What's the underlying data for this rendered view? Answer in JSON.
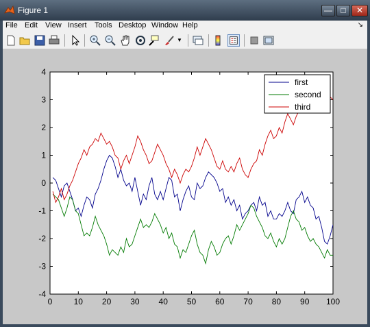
{
  "window": {
    "title": "Figure 1"
  },
  "menu": [
    "File",
    "Edit",
    "View",
    "Insert",
    "Tools",
    "Desktop",
    "Window",
    "Help"
  ],
  "toolbar": {
    "icons": [
      "new-file-icon",
      "open-folder-icon",
      "save-icon",
      "print-icon",
      "select-arrow-icon",
      "zoom-in-icon",
      "zoom-out-icon",
      "pan-hand-icon",
      "rotate-3d-icon",
      "data-cursor-icon",
      "brush-icon",
      "brush-dropdown-icon",
      "link-plot-icon",
      "colorbar-icon",
      "legend-icon",
      "hide-plot-tools-icon",
      "show-plot-tools-icon"
    ]
  },
  "colors": {
    "first": "#00008b",
    "second": "#007a00",
    "third": "#cc0000"
  },
  "chart_data": {
    "type": "line",
    "xlim": [
      0,
      100
    ],
    "ylim": [
      -4,
      4
    ],
    "xticks": [
      0,
      10,
      20,
      30,
      40,
      50,
      60,
      70,
      80,
      90,
      100
    ],
    "yticks": [
      4,
      3,
      2,
      1,
      0,
      -1,
      -2,
      -3,
      -4
    ],
    "grid": false,
    "legend_position": "top-right",
    "series": [
      {
        "name": "first",
        "color": "#00008b",
        "x": [
          1,
          2,
          3,
          4,
          5,
          6,
          7,
          8,
          9,
          10,
          11,
          12,
          13,
          14,
          15,
          16,
          17,
          18,
          19,
          20,
          21,
          22,
          23,
          24,
          25,
          26,
          27,
          28,
          29,
          30,
          31,
          32,
          33,
          34,
          35,
          36,
          37,
          38,
          39,
          40,
          41,
          42,
          43,
          44,
          45,
          46,
          47,
          48,
          49,
          50,
          51,
          52,
          53,
          54,
          55,
          56,
          57,
          58,
          59,
          60,
          61,
          62,
          63,
          64,
          65,
          66,
          67,
          68,
          69,
          70,
          71,
          72,
          73,
          74,
          75,
          76,
          77,
          78,
          79,
          80,
          81,
          82,
          83,
          84,
          85,
          86,
          87,
          88,
          89,
          90,
          91,
          92,
          93,
          94,
          95,
          96,
          97,
          98,
          99,
          100
        ],
        "y": [
          0.2,
          0.1,
          -0.2,
          -0.5,
          -0.1,
          0.0,
          -0.3,
          -0.6,
          -1.0,
          -0.9,
          -1.2,
          -0.8,
          -0.5,
          -0.6,
          -0.9,
          -0.4,
          -0.2,
          0.1,
          0.5,
          0.8,
          1.0,
          0.9,
          0.6,
          0.2,
          0.5,
          0.1,
          -0.1,
          0.0,
          -0.3,
          0.2,
          -0.3,
          -0.8,
          -0.4,
          -0.6,
          -0.1,
          0.2,
          -0.4,
          -0.6,
          -0.3,
          -0.6,
          -0.2,
          0.2,
          0.1,
          -0.5,
          -0.4,
          -1.0,
          -0.6,
          -0.3,
          -0.1,
          -0.5,
          -0.6,
          0.0,
          -0.2,
          -0.1,
          0.2,
          0.4,
          0.3,
          0.2,
          0.0,
          -0.3,
          -0.2,
          -0.7,
          -0.5,
          -0.8,
          -0.6,
          -1.0,
          -0.8,
          -1.3,
          -1.1,
          -1.0,
          -0.8,
          -0.7,
          -1.0,
          -0.5,
          -0.8,
          -0.7,
          -1.2,
          -1.0,
          -1.3,
          -1.3,
          -1.1,
          -1.2,
          -1.0,
          -0.7,
          -1.0,
          -1.1,
          -0.6,
          -0.5,
          -0.3,
          -0.7,
          -0.5,
          -0.8,
          -0.9,
          -1.3,
          -1.2,
          -1.6,
          -2.1,
          -2.2,
          -1.9,
          -1.5
        ]
      },
      {
        "name": "second",
        "color": "#007a00",
        "x": [
          1,
          2,
          3,
          4,
          5,
          6,
          7,
          8,
          9,
          10,
          11,
          12,
          13,
          14,
          15,
          16,
          17,
          18,
          19,
          20,
          21,
          22,
          23,
          24,
          25,
          26,
          27,
          28,
          29,
          30,
          31,
          32,
          33,
          34,
          35,
          36,
          37,
          38,
          39,
          40,
          41,
          42,
          43,
          44,
          45,
          46,
          47,
          48,
          49,
          50,
          51,
          52,
          53,
          54,
          55,
          56,
          57,
          58,
          59,
          60,
          61,
          62,
          63,
          64,
          65,
          66,
          67,
          68,
          69,
          70,
          71,
          72,
          73,
          74,
          75,
          76,
          77,
          78,
          79,
          80,
          81,
          82,
          83,
          84,
          85,
          86,
          87,
          88,
          89,
          90,
          91,
          92,
          93,
          94,
          95,
          96,
          97,
          98,
          99,
          100
        ],
        "y": [
          -0.4,
          -0.5,
          -0.6,
          -0.9,
          -1.2,
          -0.9,
          -0.5,
          -0.6,
          -1.0,
          -1.1,
          -1.5,
          -1.9,
          -1.8,
          -1.9,
          -1.6,
          -1.2,
          -1.5,
          -1.7,
          -1.9,
          -2.2,
          -2.6,
          -2.4,
          -2.5,
          -2.6,
          -2.3,
          -2.5,
          -2.0,
          -2.3,
          -2.2,
          -1.9,
          -1.6,
          -1.3,
          -1.6,
          -1.5,
          -1.6,
          -1.4,
          -1.1,
          -1.3,
          -1.5,
          -1.8,
          -1.6,
          -2.0,
          -1.8,
          -2.2,
          -2.3,
          -2.7,
          -2.4,
          -2.5,
          -2.2,
          -1.9,
          -1.7,
          -2.2,
          -2.5,
          -2.6,
          -2.9,
          -2.4,
          -2.1,
          -2.3,
          -2.6,
          -2.5,
          -2.2,
          -2.0,
          -1.9,
          -2.2,
          -1.9,
          -1.5,
          -1.7,
          -1.5,
          -1.3,
          -1.1,
          -0.8,
          -0.9,
          -1.2,
          -1.4,
          -1.6,
          -1.9,
          -2.0,
          -1.8,
          -2.1,
          -2.3,
          -2.0,
          -2.2,
          -2.0,
          -1.6,
          -1.2,
          -1.0,
          -1.3,
          -1.4,
          -1.7,
          -1.6,
          -1.9,
          -2.1,
          -2.0,
          -2.2,
          -2.3,
          -2.5,
          -2.7,
          -2.4,
          -2.6,
          -2.6
        ]
      },
      {
        "name": "third",
        "color": "#cc0000",
        "x": [
          1,
          2,
          3,
          4,
          5,
          6,
          7,
          8,
          9,
          10,
          11,
          12,
          13,
          14,
          15,
          16,
          17,
          18,
          19,
          20,
          21,
          22,
          23,
          24,
          25,
          26,
          27,
          28,
          29,
          30,
          31,
          32,
          33,
          34,
          35,
          36,
          37,
          38,
          39,
          40,
          41,
          42,
          43,
          44,
          45,
          46,
          47,
          48,
          49,
          50,
          51,
          52,
          53,
          54,
          55,
          56,
          57,
          58,
          59,
          60,
          61,
          62,
          63,
          64,
          65,
          66,
          67,
          68,
          69,
          70,
          71,
          72,
          73,
          74,
          75,
          76,
          77,
          78,
          79,
          80,
          81,
          82,
          83,
          84,
          85,
          86,
          87,
          88,
          89,
          90,
          91,
          92,
          93,
          94,
          95,
          96,
          97,
          98,
          99,
          100
        ],
        "y": [
          -0.3,
          -0.7,
          -0.5,
          -0.2,
          -0.6,
          -0.4,
          -0.1,
          0.1,
          0.4,
          0.7,
          0.9,
          1.2,
          1.0,
          1.3,
          1.4,
          1.6,
          1.5,
          1.8,
          1.6,
          1.4,
          1.5,
          1.3,
          1.0,
          0.9,
          0.5,
          0.8,
          1.0,
          0.7,
          1.0,
          1.3,
          1.7,
          1.5,
          1.2,
          1.0,
          0.7,
          0.8,
          1.1,
          1.4,
          1.2,
          1.0,
          0.7,
          0.5,
          0.2,
          0.5,
          0.3,
          0.0,
          0.3,
          0.5,
          0.4,
          0.6,
          0.9,
          1.3,
          1.0,
          1.3,
          1.6,
          1.4,
          1.2,
          0.9,
          0.6,
          0.5,
          0.8,
          0.5,
          0.4,
          0.6,
          0.4,
          0.7,
          0.9,
          0.5,
          0.3,
          0.2,
          0.5,
          0.7,
          0.8,
          1.2,
          1.0,
          1.4,
          1.7,
          1.9,
          1.6,
          1.7,
          2.0,
          1.8,
          2.2,
          2.5,
          2.3,
          2.1,
          2.4,
          2.6,
          2.9,
          2.7,
          3.0,
          3.3,
          3.1,
          3.4,
          3.5,
          3.3,
          3.2,
          3.4,
          3.1,
          3.0
        ]
      }
    ]
  }
}
